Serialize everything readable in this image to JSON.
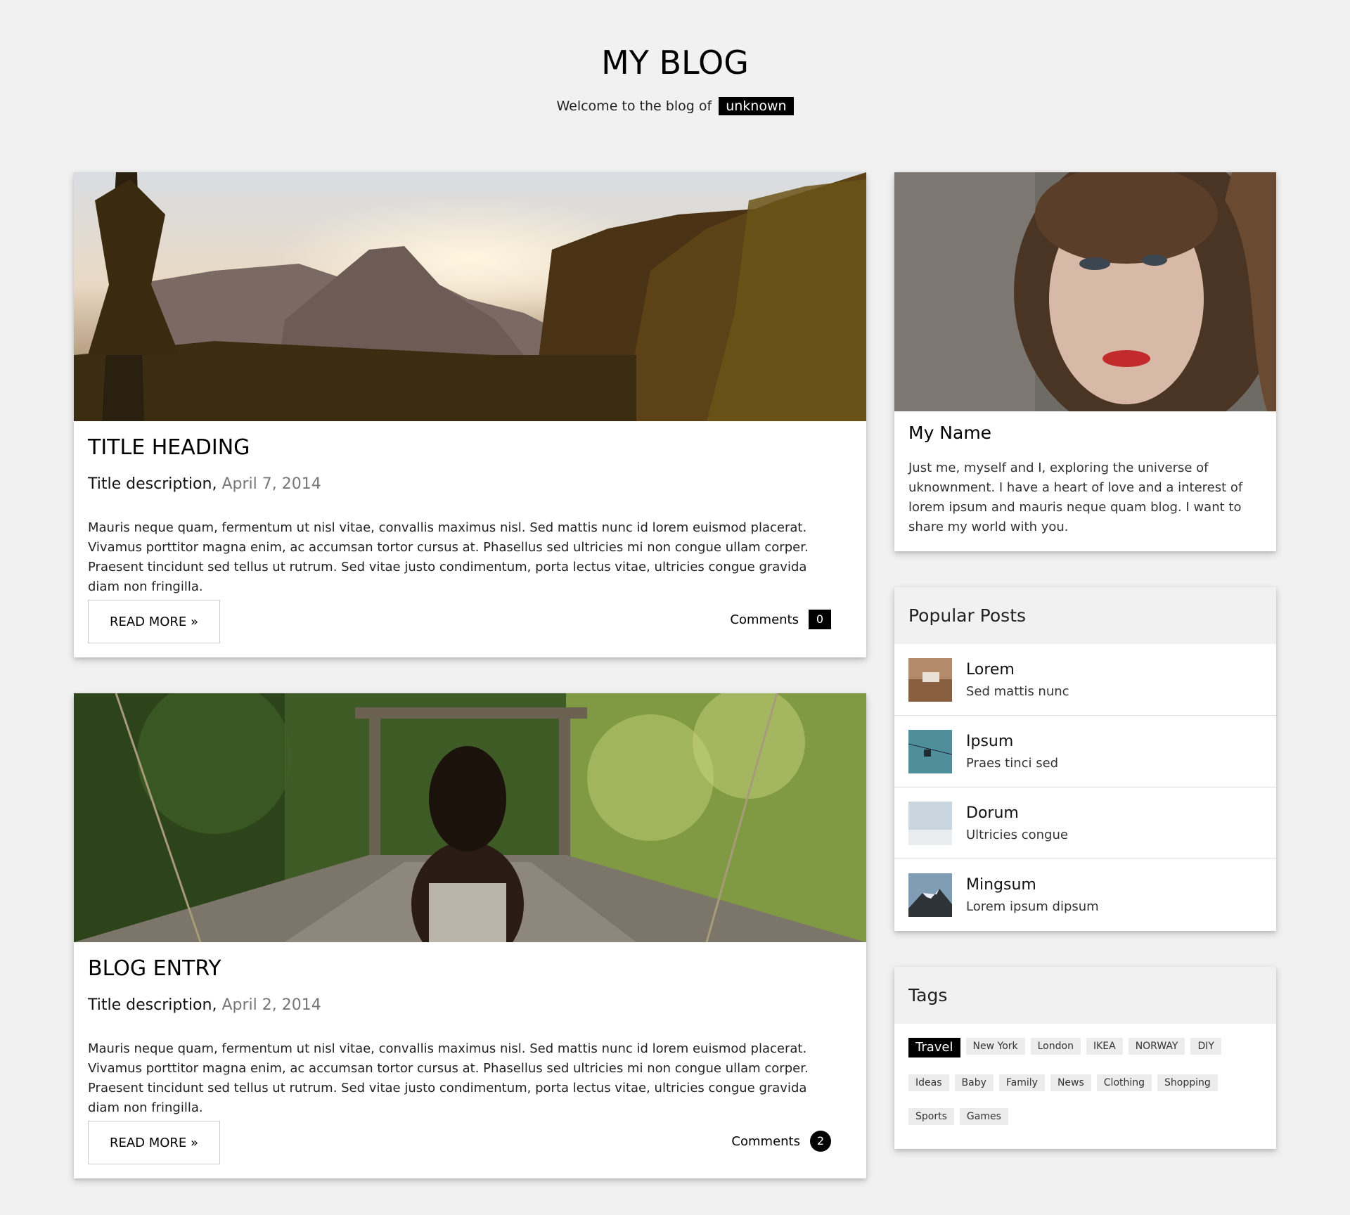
{
  "header": {
    "title": "MY BLOG",
    "welcome_text": "Welcome to the blog of",
    "welcome_name": "unknown"
  },
  "posts": [
    {
      "title": "TITLE HEADING",
      "description": "Title description,",
      "date": "April 7, 2014",
      "text": "Mauris neque quam, fermentum ut nisl vitae, convallis maximus nisl. Sed mattis nunc id lorem euismod placerat. Vivamus porttitor magna enim, ac accumsan tortor cursus at. Phasellus sed ultricies mi non congue ullam corper. Praesent tincidunt sed tellus ut rutrum. Sed vitae justo condimentum, porta lectus vitae, ultricies congue gravida diam non fringilla.",
      "read_more": "READ MORE »",
      "comments_label": "Comments",
      "comments_count": "0"
    },
    {
      "title": "BLOG ENTRY",
      "description": "Title description,",
      "date": "April 2, 2014",
      "text": "Mauris neque quam, fermentum ut nisl vitae, convallis maximus nisl. Sed mattis nunc id lorem euismod placerat. Vivamus porttitor magna enim, ac accumsan tortor cursus at. Phasellus sed ultricies mi non congue ullam corper. Praesent tincidunt sed tellus ut rutrum. Sed vitae justo condimentum, porta lectus vitae, ultricies congue gravida diam non fringilla.",
      "read_more": "READ MORE »",
      "comments_label": "Comments",
      "comments_count": "2"
    }
  ],
  "profile": {
    "name": "My Name",
    "text": "Just me, myself and I, exploring the universe of uknownment. I have a heart of love and a interest of lorem ipsum and mauris neque quam blog. I want to share my world with you."
  },
  "popular": {
    "heading": "Popular Posts",
    "items": [
      {
        "title": "Lorem",
        "subtitle": "Sed mattis nunc"
      },
      {
        "title": "Ipsum",
        "subtitle": "Praes tinci sed"
      },
      {
        "title": "Dorum",
        "subtitle": "Ultricies congue"
      },
      {
        "title": "Mingsum",
        "subtitle": "Lorem ipsum dipsum"
      }
    ]
  },
  "tags": {
    "heading": "Tags",
    "items": [
      "Travel",
      "New York",
      "London",
      "IKEA",
      "NORWAY",
      "DIY",
      "Ideas",
      "Baby",
      "Family",
      "News",
      "Clothing",
      "Shopping",
      "Sports",
      "Games"
    ],
    "active": "Travel"
  },
  "colors": {
    "background": "#f1f1f1",
    "card": "#ffffff",
    "accent": "#000000"
  }
}
